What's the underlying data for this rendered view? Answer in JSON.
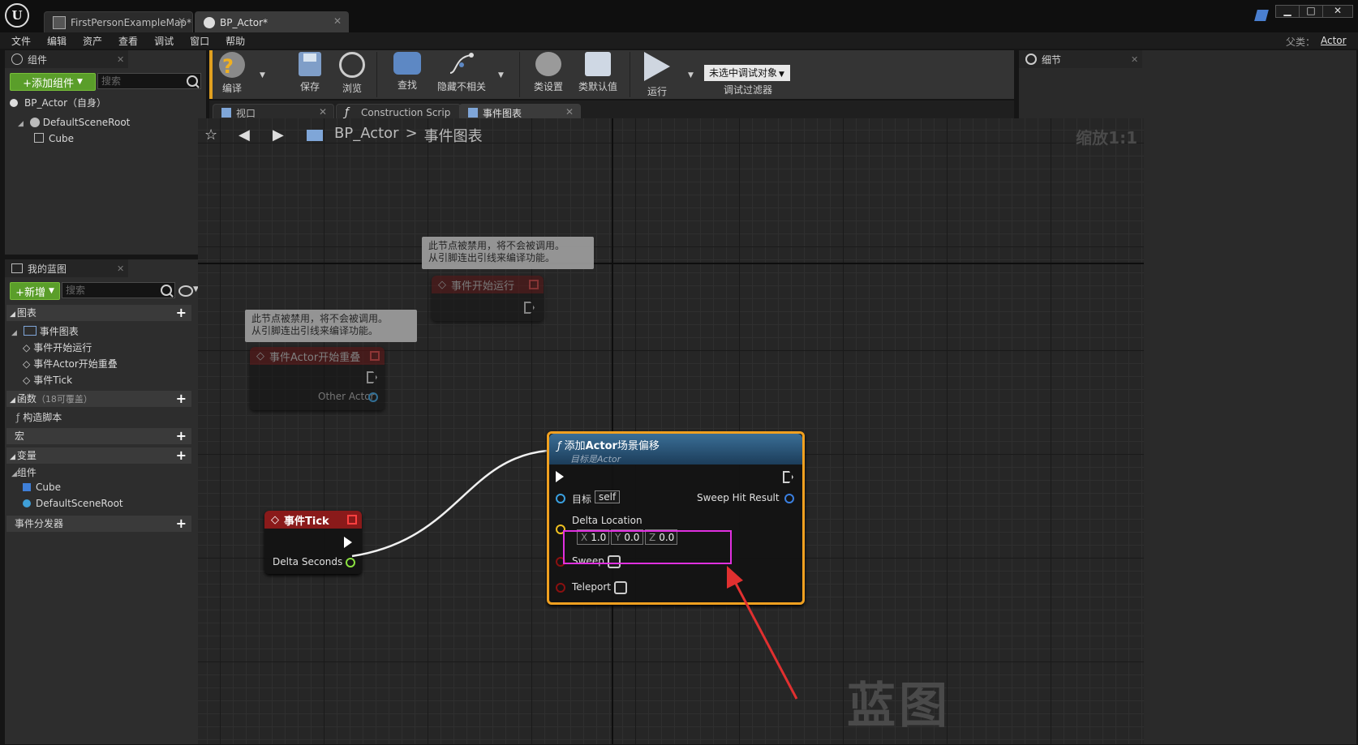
{
  "titlebar": {
    "tabs": [
      {
        "label": "FirstPersonExampleMap*"
      },
      {
        "label": "BP_Actor*"
      }
    ],
    "logo_text": "U"
  },
  "menubar": {
    "items": [
      "文件",
      "编辑",
      "资产",
      "查看",
      "调试",
      "窗口",
      "帮助"
    ],
    "parent_label": "父类：",
    "parent_value": "Actor"
  },
  "components_panel": {
    "tab_label": "组件",
    "add_button": "+添加组件",
    "search_placeholder": "搜索",
    "self_item": "BP_Actor（自身）",
    "tree": [
      "DefaultSceneRoot",
      "Cube"
    ]
  },
  "my_blueprint": {
    "tab_label": "我的蓝图",
    "new_button": "+新增",
    "search_placeholder": "搜索",
    "sections": {
      "graphs": "图表",
      "event_graph": "事件图表",
      "events": [
        "事件开始运行",
        "事件Actor开始重叠",
        "事件Tick"
      ],
      "functions": "函数",
      "functions_note": "（18可覆盖）",
      "construction": "构造脚本",
      "macros": "宏",
      "variables": "变量",
      "components": "组件",
      "component_items": [
        "Cube",
        "DefaultSceneRoot"
      ],
      "dispatchers": "事件分发器"
    }
  },
  "toolbar": {
    "compile": "编译",
    "save": "保存",
    "browse": "浏览",
    "find": "查找",
    "hide_unrelated": "隐藏不相关",
    "class_settings": "类设置",
    "class_defaults": "类默认值",
    "play": "运行",
    "debug_select": "未选中调试对象",
    "debug_filter": "调试过滤器"
  },
  "editor_tabs": [
    {
      "label": "视口"
    },
    {
      "label": "Construction Scrip"
    },
    {
      "label": "事件图表"
    }
  ],
  "graph": {
    "breadcrumb_root": "BP_Actor",
    "breadcrumb_sep": ">",
    "breadcrumb_current": "事件图表",
    "zoom": "缩放1:1",
    "watermark": "蓝图",
    "comment_text_1": "此节点被禁用，将不会被调用。",
    "comment_text_2": "从引脚连出引线来编译功能。",
    "node_begin_play": "事件开始运行",
    "node_overlap": "事件Actor开始重叠",
    "node_overlap_pin": "Other Actor",
    "node_tick": "事件Tick",
    "node_tick_pin": "Delta Seconds",
    "func_title_prefix": "添加",
    "func_title_bold": "Actor",
    "func_title_suffix": "场景偏移",
    "func_subtitle": "目标是Actor",
    "pin_target": "目标",
    "pin_target_value": "self",
    "pin_sweep_hit": "Sweep Hit Result",
    "pin_delta_location": "Delta Location",
    "vec_x_label": "X",
    "vec_x": "1.0",
    "vec_y_label": "Y",
    "vec_y": "0.0",
    "vec_z_label": "Z",
    "vec_z": "0.0",
    "pin_sweep": "Sweep",
    "pin_teleport": "Teleport"
  },
  "details_panel": {
    "tab_label": "细节"
  },
  "colors": {
    "highlight_box": "#e030e0",
    "arrow": "#e03030",
    "func_border": "#f0a020",
    "event_header": "#8a1a1a"
  }
}
